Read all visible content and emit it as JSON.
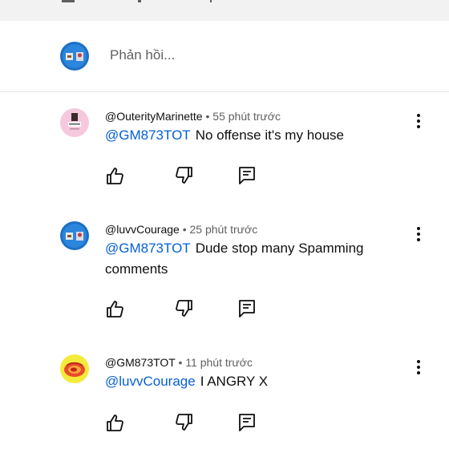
{
  "reply": {
    "placeholder": "Phản hồi..."
  },
  "comments": [
    {
      "author": "@OuterityMarinette",
      "time": "55 phút trước",
      "mention": "@GM873TOT",
      "text": "No offense it's my house"
    },
    {
      "author": "@luvvCourage",
      "time": "25 phút trước",
      "mention": "@GM873TOT",
      "text": "Dude stop many Spamming comments"
    },
    {
      "author": "@GM873TOT",
      "time": "11 phút trước",
      "mention": "@luvvCourage",
      "text": "I ANGRY X"
    }
  ],
  "meta_separator": " • ",
  "colors": {
    "mention": "#065fd4",
    "secondary_text": "#606060",
    "top_bar": "#f2f2f2"
  },
  "icons": [
    "like-icon",
    "dislike-icon",
    "reply-icon",
    "more-vert-icon"
  ]
}
